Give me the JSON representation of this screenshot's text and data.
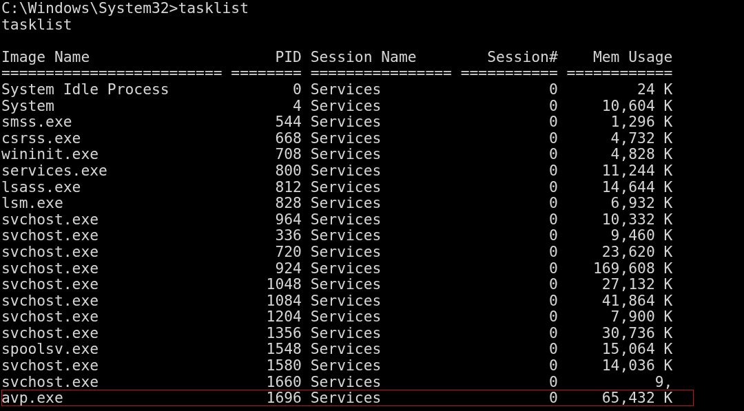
{
  "console": {
    "lines": [
      "C:\\Windows\\System32>tasklist",
      "tasklist"
    ],
    "table": {
      "columns": [
        "Image Name",
        "PID",
        "Session Name",
        "Session#",
        "Mem Usage"
      ],
      "separators": [
        "=========================",
        "========",
        "================",
        "===========",
        "============"
      ],
      "rows": [
        {
          "cells": [
            "System Idle Process",
            "0",
            "Services",
            "0",
            "24 K"
          ],
          "highlighted": false
        },
        {
          "cells": [
            "System",
            "4",
            "Services",
            "0",
            "10,604 K"
          ],
          "highlighted": false
        },
        {
          "cells": [
            "smss.exe",
            "544",
            "Services",
            "0",
            "1,296 K"
          ],
          "highlighted": false
        },
        {
          "cells": [
            "csrss.exe",
            "668",
            "Services",
            "0",
            "4,732 K"
          ],
          "highlighted": false
        },
        {
          "cells": [
            "wininit.exe",
            "708",
            "Services",
            "0",
            "4,828 K"
          ],
          "highlighted": false
        },
        {
          "cells": [
            "services.exe",
            "800",
            "Services",
            "0",
            "11,244 K"
          ],
          "highlighted": false
        },
        {
          "cells": [
            "lsass.exe",
            "812",
            "Services",
            "0",
            "14,644 K"
          ],
          "highlighted": false
        },
        {
          "cells": [
            "lsm.exe",
            "828",
            "Services",
            "0",
            "6,932 K"
          ],
          "highlighted": false
        },
        {
          "cells": [
            "svchost.exe",
            "964",
            "Services",
            "0",
            "10,332 K"
          ],
          "highlighted": false
        },
        {
          "cells": [
            "svchost.exe",
            "336",
            "Services",
            "0",
            "9,460 K"
          ],
          "highlighted": false
        },
        {
          "cells": [
            "svchost.exe",
            "720",
            "Services",
            "0",
            "23,620 K"
          ],
          "highlighted": false
        },
        {
          "cells": [
            "svchost.exe",
            "924",
            "Services",
            "0",
            "169,608 K"
          ],
          "highlighted": false
        },
        {
          "cells": [
            "svchost.exe",
            "1048",
            "Services",
            "0",
            "27,132 K"
          ],
          "highlighted": false
        },
        {
          "cells": [
            "svchost.exe",
            "1084",
            "Services",
            "0",
            "41,864 K"
          ],
          "highlighted": false
        },
        {
          "cells": [
            "svchost.exe",
            "1204",
            "Services",
            "0",
            "7,900 K"
          ],
          "highlighted": false
        },
        {
          "cells": [
            "svchost.exe",
            "1356",
            "Services",
            "0",
            "30,736 K"
          ],
          "highlighted": false
        },
        {
          "cells": [
            "spoolsv.exe",
            "1548",
            "Services",
            "0",
            "15,064 K"
          ],
          "highlighted": false
        },
        {
          "cells": [
            "svchost.exe",
            "1580",
            "Services",
            "0",
            "14,036 K"
          ],
          "highlighted": false
        },
        {
          "cells": [
            "svchost.exe",
            "1660",
            "Services",
            "0",
            "9,"
          ],
          "highlighted": false
        },
        {
          "cells": [
            "avp.exe",
            "1696",
            "Services",
            "0",
            "65,432 K"
          ],
          "highlighted": true
        }
      ]
    }
  }
}
